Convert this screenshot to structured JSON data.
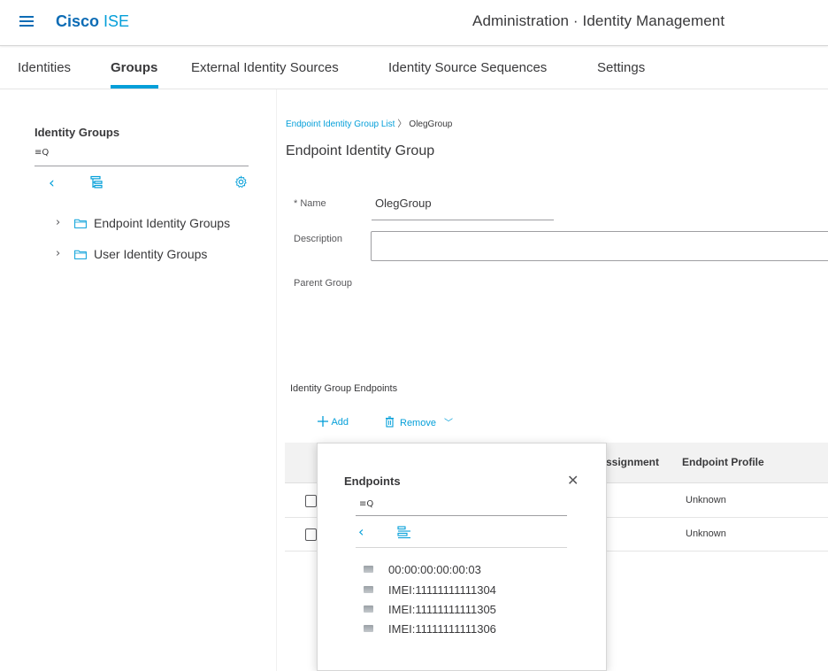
{
  "header": {
    "brand_strong": "Cisco",
    "brand_rest": " ISE",
    "page_title": "Administration · Identity Management"
  },
  "tabs": [
    {
      "label": "Identities",
      "active": false
    },
    {
      "label": "Groups",
      "active": true
    },
    {
      "label": "External Identity Sources",
      "active": false
    },
    {
      "label": "Identity Source Sequences",
      "active": false
    },
    {
      "label": "Settings",
      "active": false
    }
  ],
  "left_panel": {
    "title": "Identity Groups",
    "search_icon": "search-filter-icon",
    "tree": [
      {
        "label": "Endpoint Identity Groups"
      },
      {
        "label": "User Identity Groups"
      }
    ]
  },
  "breadcrumb": {
    "link": "Endpoint Identity Group List",
    "current": "OlegGroup"
  },
  "form": {
    "title": "Endpoint Identity Group",
    "name_label": "* Name",
    "name_value": "OlegGroup",
    "description_label": "Description",
    "description_value": "",
    "parent_label": "Parent Group"
  },
  "endpoints_section": {
    "title": "Identity Group Endpoints",
    "add_label": "Add",
    "remove_label": "Remove",
    "columns": [
      "ssignment",
      "Endpoint Profile"
    ],
    "rows": [
      {
        "endpoint_profile": "Unknown"
      },
      {
        "endpoint_profile": "Unknown"
      }
    ]
  },
  "popover": {
    "title": "Endpoints",
    "items": [
      "00:00:00:00:00:03",
      "IMEI:11111111111304",
      "IMEI:11111111111305",
      "IMEI:11111111111306"
    ]
  },
  "colors": {
    "accent": "#049fd9",
    "brand": "#0d6cb5",
    "text": "#39393b"
  }
}
